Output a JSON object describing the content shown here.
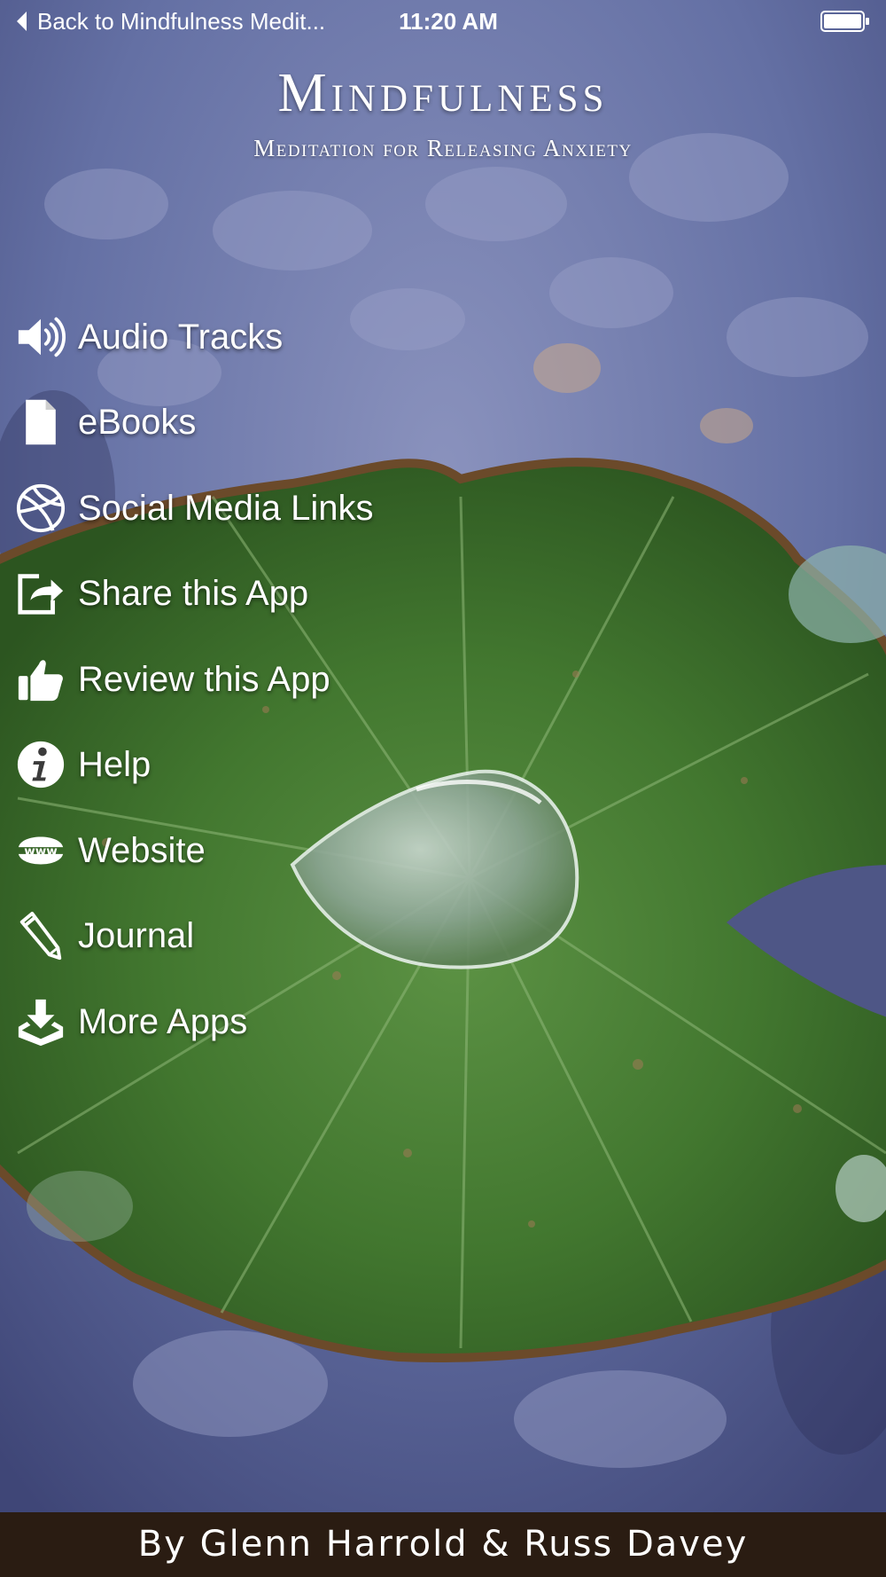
{
  "status_bar": {
    "back_label": "Back to Mindfulness Medit...",
    "time": "11:20 AM"
  },
  "header": {
    "title": "Mindfulness",
    "subtitle": "Meditation for Releasing Anxiety"
  },
  "menu": {
    "items": [
      {
        "label": "Audio Tracks",
        "icon": "speaker-icon"
      },
      {
        "label": "eBooks",
        "icon": "document-icon"
      },
      {
        "label": "Social Media Links",
        "icon": "globe-ball-icon"
      },
      {
        "label": "Share this App",
        "icon": "share-icon"
      },
      {
        "label": "Review this App",
        "icon": "thumbs-up-icon"
      },
      {
        "label": "Help",
        "icon": "info-icon"
      },
      {
        "label": "Website",
        "icon": "www-icon"
      },
      {
        "label": "Journal",
        "icon": "pencil-icon"
      },
      {
        "label": "More Apps",
        "icon": "download-tray-icon"
      }
    ]
  },
  "footer": {
    "credit": "By Glenn Harrold & Russ Davey"
  },
  "colors": {
    "water": "#5d6b9c",
    "leaf": "#3f7a33",
    "footer_bg": "#2a1c12",
    "text": "#ffffff"
  }
}
